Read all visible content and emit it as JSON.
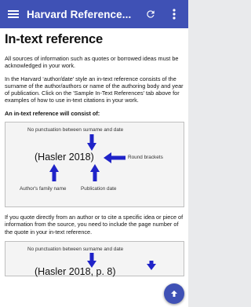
{
  "app": {
    "title": "Harvard Reference...",
    "icons": {
      "menu": "menu-icon",
      "refresh": "refresh-icon",
      "more": "more-vert-icon",
      "fab": "up-arrow-icon"
    },
    "colors": {
      "primary": "#3f51b5",
      "arrow": "#1f23c8"
    }
  },
  "page": {
    "heading": "In-text reference",
    "paragraph1": "All sources of information such as quotes or borrowed ideas must be acknowledged in your work.",
    "paragraph2": "In the Harvard  ‘author/date’ style an in-text reference consists of the surname of the author/authors or name of the authoring body and year of publication.  Click on the 'Sample In-Text References' tab above for examples of how to use in-text citations in your work.",
    "lead": "An in-text reference will consist of:",
    "paragraph3": "If you quote directly from an author or to cite a specific idea or piece of information from the source, you need to include the page number of the quote in your in-text reference."
  },
  "figure1": {
    "top_note": "No punctuation between surname and date",
    "citation": "(Hasler 2018)",
    "bracket_note": "Round brackets",
    "author_note": "Author's family name",
    "date_note": "Publication date"
  },
  "figure2": {
    "top_note": "No punctuation between surname and date",
    "citation": "(Hasler 2018, p. 8)"
  }
}
